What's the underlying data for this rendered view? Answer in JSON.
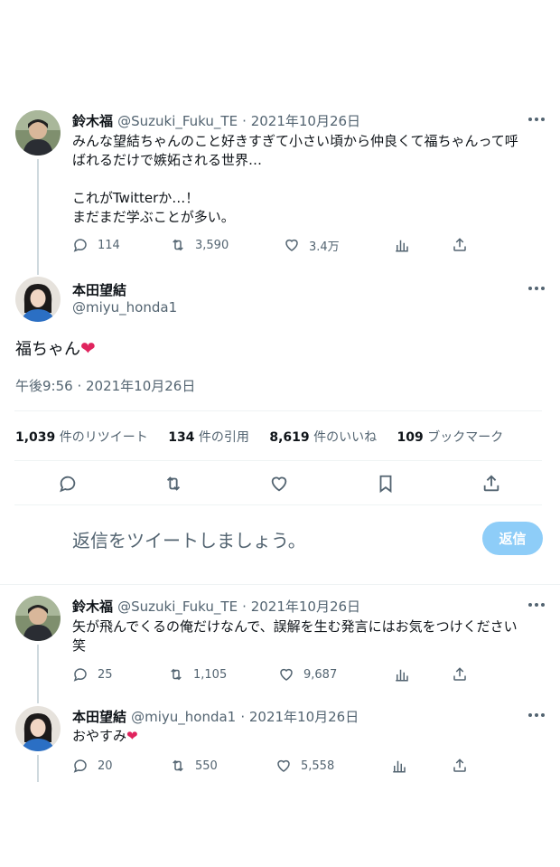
{
  "tweet1": {
    "name": "鈴木福",
    "handle": "@Suzuki_Fuku_TE",
    "date": "· 2021年10月26日",
    "line1": "みんな望結ちゃんのこと好きすぎて小さい頃から仲良くて福ちゃんって呼",
    "line2": "ばれるだけで嫉妬される世界…",
    "line3": "これがTwitterか…！",
    "line4": "まだまだ学ぶことが多い。",
    "replies": "114",
    "retweets": "3,590",
    "likes": "3.4万"
  },
  "main": {
    "name": "本田望結",
    "handle": "@miyu_honda1",
    "text": "福ちゃん",
    "heart": "❤",
    "timestamp": "午後9:56 · 2021年10月26日",
    "stats": [
      {
        "num": "1,039",
        "label": "件のリツイート"
      },
      {
        "num": "134",
        "label": "件の引用"
      },
      {
        "num": "8,619",
        "label": "件のいいね"
      },
      {
        "num": "109",
        "label": "ブックマーク"
      }
    ]
  },
  "reply_box": {
    "placeholder": "返信をツイートしましょう。",
    "button": "返信",
    "button_color": "#8ecdf8"
  },
  "tweet3": {
    "name": "鈴木福",
    "handle": "@Suzuki_Fuku_TE",
    "date": "· 2021年10月26日",
    "line1": "矢が飛んでくるの俺だけなんで、誤解を生む発言にはお気をつけください",
    "line2": "笑",
    "replies": "25",
    "retweets": "1,105",
    "likes": "9,687"
  },
  "tweet4": {
    "name": "本田望結",
    "handle": "@miyu_honda1",
    "date": "· 2021年10月26日",
    "text": "おやすみ",
    "heart": "❤",
    "replies": "20",
    "retweets": "550",
    "likes": "5,558"
  },
  "colors": {
    "heart": "#e0245e",
    "secondary_text": "#536471",
    "thread_line": "#cfd9de"
  }
}
